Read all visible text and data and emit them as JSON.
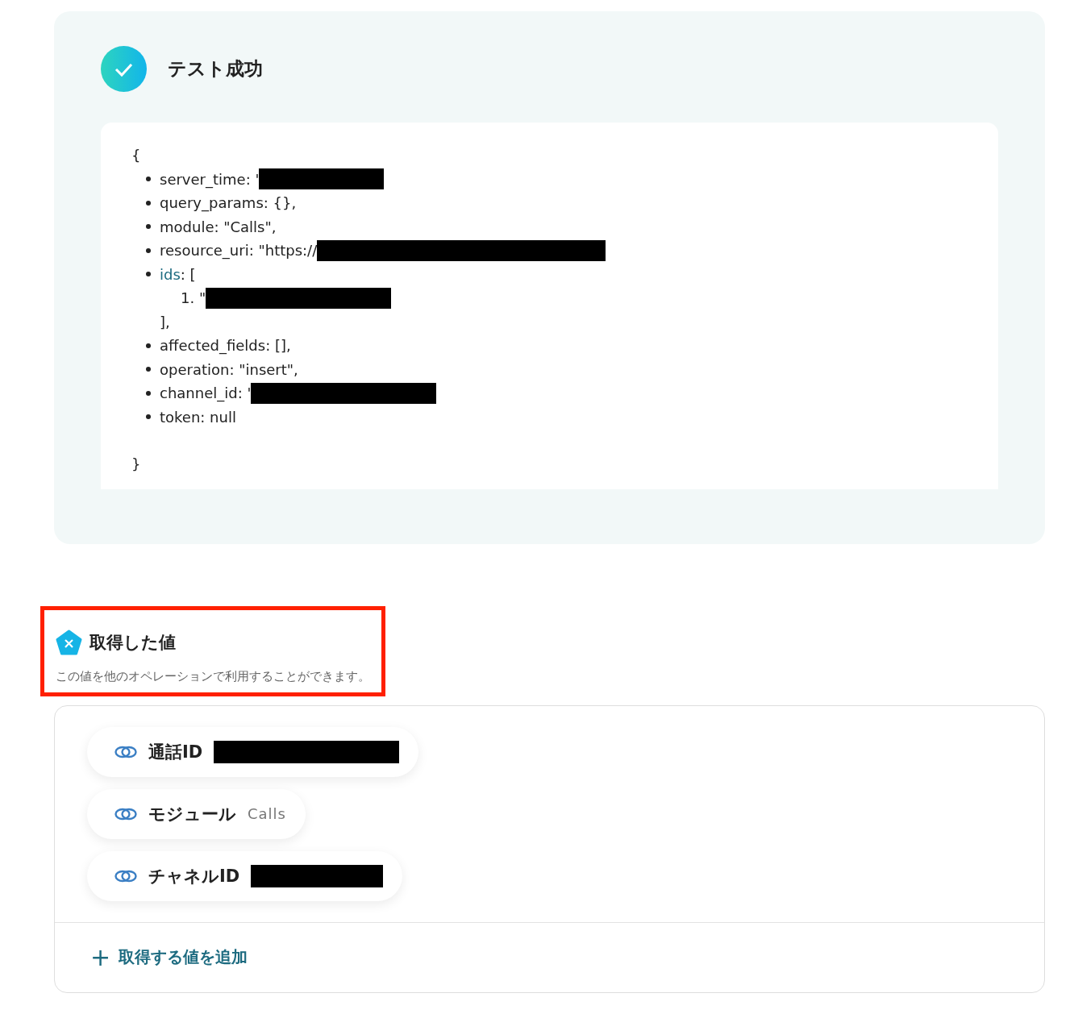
{
  "test_result": {
    "kind": "success",
    "title": "テスト成功",
    "payload": {
      "open": "{",
      "close": "}",
      "items": [
        {
          "kind": "field",
          "text": "server_time: '",
          "redacted": true
        },
        {
          "kind": "field",
          "text": "query_params: {},",
          "redacted": false
        },
        {
          "kind": "field",
          "text": "module: \"Calls\",",
          "redacted": false
        },
        {
          "kind": "field",
          "text": "resource_uri: \"https://",
          "redacted": true
        },
        {
          "kind": "array",
          "key": "ids",
          "text": ": [",
          "close": "],",
          "children": [
            {
              "number": "1.",
              "text": "\"",
              "redacted": true
            }
          ]
        },
        {
          "kind": "field",
          "text": "affected_fields: [],",
          "redacted": false
        },
        {
          "kind": "field",
          "text": "operation: \"insert\",",
          "redacted": false
        },
        {
          "kind": "field",
          "text": "channel_id: '",
          "redacted": true
        },
        {
          "kind": "field",
          "text": "token: null",
          "redacted": false
        }
      ]
    }
  },
  "acquired_values": {
    "title": "取得した値",
    "description": "この値を他のオペレーションで利用することができます。",
    "highlighted": true,
    "values": [
      {
        "label": "通話ID",
        "redacted": true
      },
      {
        "label": "モジュール",
        "value": "Calls",
        "redacted": false
      },
      {
        "label": "チャネルID",
        "redacted": true
      }
    ],
    "add_button": {
      "icon": "+",
      "label": "取得する値を追加"
    }
  }
}
